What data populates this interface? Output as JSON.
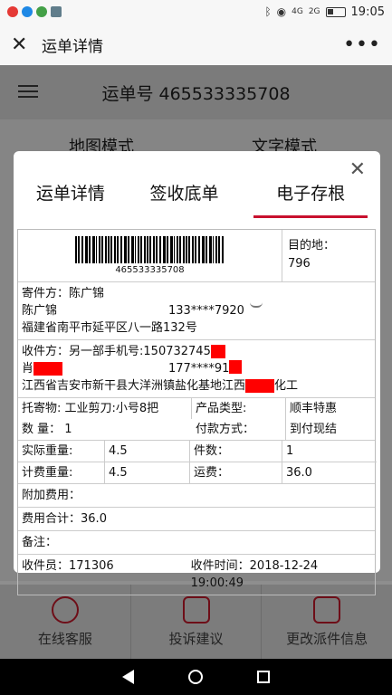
{
  "status_bar": {
    "time": "19:05",
    "network1": "4G",
    "network2": "2G"
  },
  "header": {
    "title": "运单详情"
  },
  "under": {
    "title": "运单号 465533335708",
    "tabs": [
      "地图模式",
      "文字模式"
    ],
    "actions": [
      {
        "label": "在线客服",
        "icon": "headset-icon"
      },
      {
        "label": "投诉建议",
        "icon": "edit-icon"
      },
      {
        "label": "更改派件信息",
        "icon": "box-icon"
      }
    ]
  },
  "modal": {
    "tabs": [
      "运单详情",
      "签收底单",
      "电子存根"
    ],
    "active_tab": 2,
    "barcode_number": "465533335708",
    "destination_label": "目的地：",
    "destination_value": "796",
    "sender_label": "寄件方：",
    "sender_name": "陈广锦",
    "sender_contact": "陈广锦",
    "sender_phone": "133****7920",
    "sender_address": "福建省南平市延平区八一路132号",
    "receiver_label": "收件方：",
    "receiver_phone_label": "另一部手机号:150732745",
    "receiver_name_prefix": "肖",
    "receiver_phone": "177****91",
    "receiver_address_prefix": "江西省吉安市新干县大洋洲镇盐化基地江西",
    "receiver_address_suffix": "化工",
    "goods_label": "托寄物:",
    "goods_value": "工业剪刀:小号8把",
    "product_type_label": "产品类型:",
    "product_type_value": "顺丰特惠",
    "quantity_label": "数  量：",
    "quantity_value": "1",
    "payment_label": "付款方式：",
    "payment_value": "到付现结",
    "actual_weight_label": "实际重量:",
    "actual_weight_value": "4.5",
    "pieces_label": "件数：",
    "pieces_value": "1",
    "billed_weight_label": "计费重量:",
    "billed_weight_value": "4.5",
    "freight_label": "运费：",
    "freight_value": "36.0",
    "extra_fee_label": "附加费用：",
    "total_fee_label": "费用合计：",
    "total_fee_value": "36.0",
    "remark_label": "备注：",
    "courier_label": "收件员：",
    "courier_value": "171306",
    "pickup_time_label": "收件时间：",
    "pickup_time_value": "2018-12-24 19:00:49"
  }
}
